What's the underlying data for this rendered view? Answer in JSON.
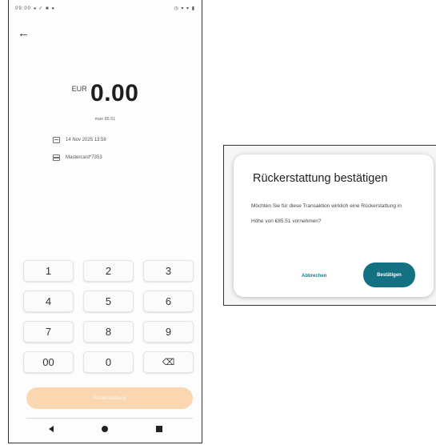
{
  "status_bar": {
    "left": "09:00 ◂ ✓ ■ ●",
    "right": "◷ ▾ ▾ ▮"
  },
  "header": {
    "back_icon": "arrow-left-icon",
    "back_glyph": "←"
  },
  "amount": {
    "currency": "EUR",
    "value": "0.00",
    "max": "max 85.51"
  },
  "transaction": {
    "date": "14 Nov 2025 13:58",
    "card": "Mastercard*7353"
  },
  "keypad": {
    "keys": [
      "1",
      "2",
      "3",
      "4",
      "5",
      "6",
      "7",
      "8",
      "9",
      "00",
      "0"
    ],
    "backspace_icon": "backspace-icon",
    "backspace_glyph": "⌫"
  },
  "refund_button": {
    "label": "Rückerstattung"
  },
  "navbar": {
    "icons": [
      "nav-back-icon",
      "nav-home-icon",
      "nav-recents-icon"
    ]
  },
  "dialog": {
    "title": "Rückerstattung bestätigen",
    "body": "Möchten Sie für diese Transaktion wirklich eine Rückerstattung in Höhe von €85.51 vornehmen?",
    "cancel_label": "Abbrechen",
    "confirm_label": "Bestätigen"
  },
  "colors": {
    "accent": "#137181",
    "button_disabled": "#fad7b0",
    "text": "#222222"
  }
}
